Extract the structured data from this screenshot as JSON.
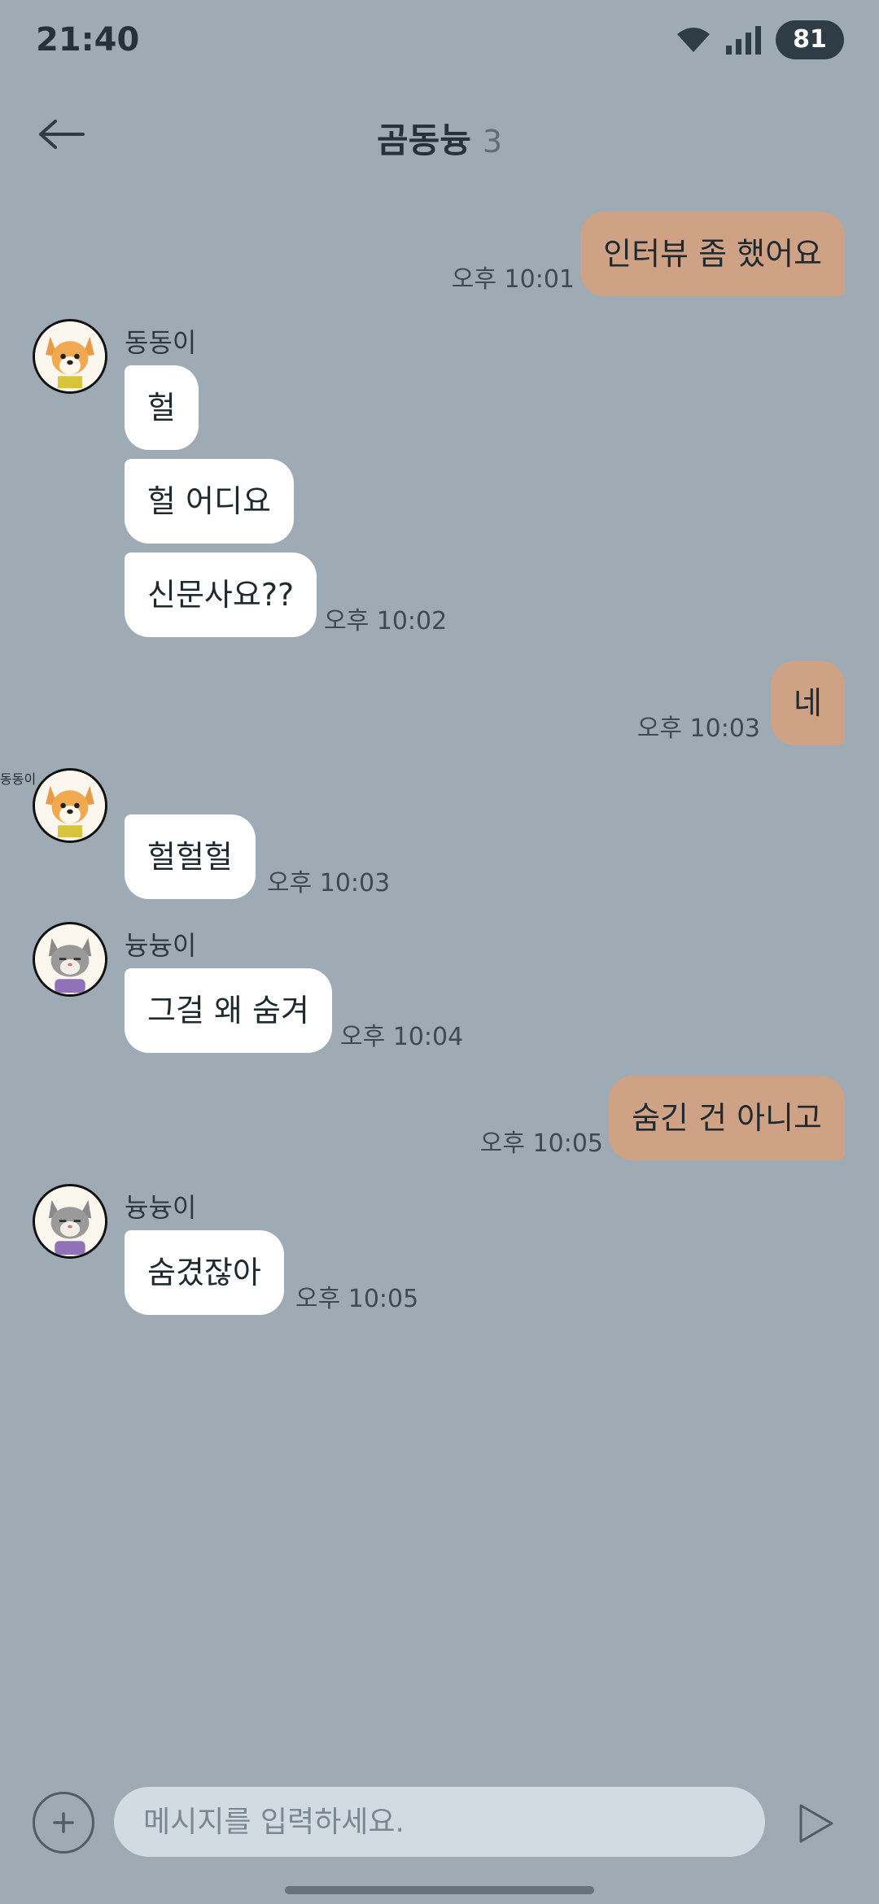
{
  "status_bar": {
    "time": "21:40",
    "battery": "81"
  },
  "header": {
    "title": "곰동늉",
    "member_count": "3"
  },
  "messages": [
    {
      "direction": "out",
      "text": "인터뷰 좀 했어요",
      "time": "오후 10:01"
    },
    {
      "direction": "in",
      "sender": "동동이",
      "avatar": "dog",
      "texts": [
        "헐",
        "헐 어디요",
        "신문사요??"
      ],
      "time": "오후 10:02"
    },
    {
      "direction": "out",
      "text": "네",
      "time": "오후 10:03"
    },
    {
      "direction": "in",
      "sender": "동동이",
      "avatar": "dog",
      "texts": [
        "헐헐헐"
      ],
      "time": "오후 10:03"
    },
    {
      "direction": "in",
      "sender": "늉늉이",
      "avatar": "cat",
      "texts": [
        "그걸 왜 숨겨"
      ],
      "time": "오후 10:04"
    },
    {
      "direction": "out",
      "text": "숨긴 건 아니고",
      "time": "오후 10:05"
    },
    {
      "direction": "in",
      "sender": "늉늉이",
      "avatar": "cat",
      "texts": [
        "숨겼잖아"
      ],
      "time": "오후 10:05"
    }
  ],
  "input": {
    "placeholder": "메시지를 입력하세요."
  },
  "icons": {
    "back": "arrow-left-icon",
    "wifi": "wifi-icon",
    "signal": "signal-icon",
    "add": "plus-icon",
    "send": "send-icon"
  },
  "colors": {
    "background": "#9eabb4",
    "incoming_bubble": "#ffffff",
    "outgoing_bubble": "#d0a285",
    "input_field": "#d2dbe2"
  }
}
